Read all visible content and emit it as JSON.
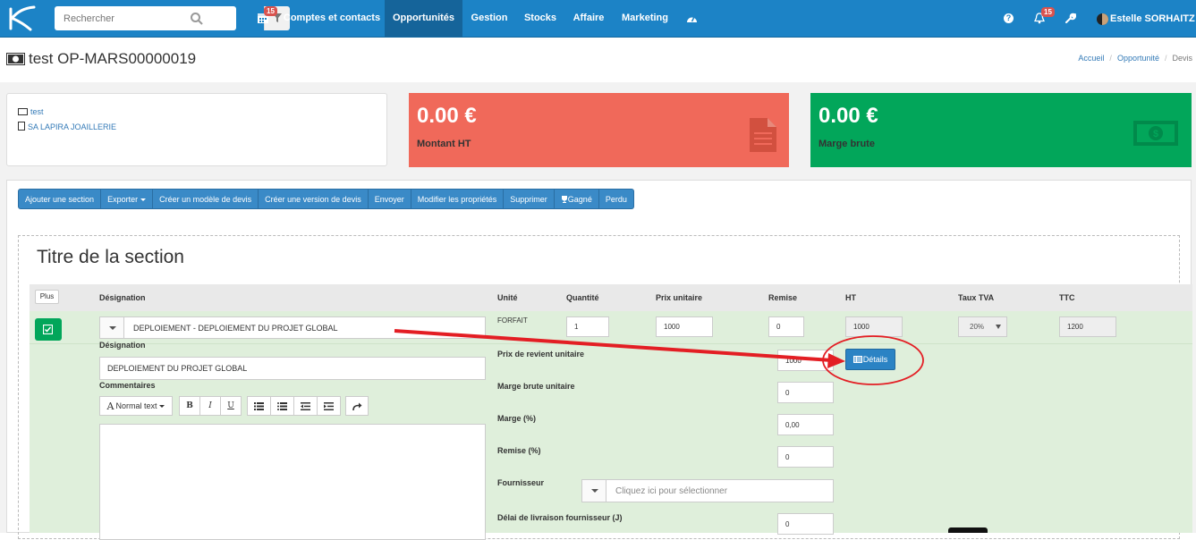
{
  "search": {
    "placeholder": "Rechercher"
  },
  "topnav": {
    "calendar_badge": "15",
    "items": [
      "Comptes et contacts",
      "Opportunités",
      "Gestion",
      "Stocks",
      "Affaire",
      "Marketing"
    ],
    "notifications_badge": "15",
    "user_name": "Estelle SORHAITZ"
  },
  "page": {
    "title": "test OP-MARS00000019",
    "breadcrumb": [
      "Accueil",
      "Opportunité",
      "Devis"
    ]
  },
  "info": {
    "links": [
      "test",
      "SA LAPIRA JOAILLERIE"
    ]
  },
  "cards": [
    {
      "value": "0.00 €",
      "label": "Montant HT",
      "color": "#f0695a",
      "icon": "document-icon"
    },
    {
      "value": "0.00 €",
      "label": "Marge brute",
      "color": "#02a65a",
      "icon": "money-icon"
    }
  ],
  "toolbar": {
    "buttons": [
      "Ajouter une section",
      "Exporter",
      "Créer un modèle de devis",
      "Créer une version de devis",
      "Envoyer",
      "Modifier les propriétés",
      "Supprimer",
      "Gagné",
      "Perdu"
    ]
  },
  "section": {
    "title": "Titre de la section",
    "plus_label": "Plus",
    "columns": [
      "Désignation",
      "Unité",
      "Quantité",
      "Prix unitaire",
      "Remise",
      "HT",
      "Taux TVA",
      "TTC"
    ]
  },
  "line": {
    "product": "DEPLOIEMENT - DEPLOIEMENT DU PROJET GLOBAL",
    "unit": "FORFAIT",
    "quantity": "1",
    "unit_price": "1000",
    "discount": "0",
    "ht": "1000",
    "tva": "20%",
    "ttc": "1200",
    "designation_label": "Désignation",
    "designation": "DEPLOIEMENT DU PROJET GLOBAL",
    "comments_label": "Commentaires",
    "editor_style": "Normal text",
    "cost_label": "Prix de revient unitaire",
    "cost": "1000",
    "details_label": "Détails",
    "margin_unit_label": "Marge brute unitaire",
    "margin_unit": "0",
    "margin_pct_label": "Marge (%)",
    "margin_pct": "0,00",
    "discount_pct_label": "Remise (%)",
    "discount_pct": "0",
    "supplier_label": "Fournisseur",
    "supplier_placeholder": "Cliquez ici pour sélectionner",
    "delay_label": "Délai de livraison fournisseur (J)",
    "delay": "0"
  },
  "colors": {
    "nav": "#1c83c6",
    "nav_active": "#15649a",
    "red_card": "#f0695a",
    "green_card": "#02a65a",
    "row_bg": "#dfefdb",
    "annotation": "#e31e24"
  }
}
